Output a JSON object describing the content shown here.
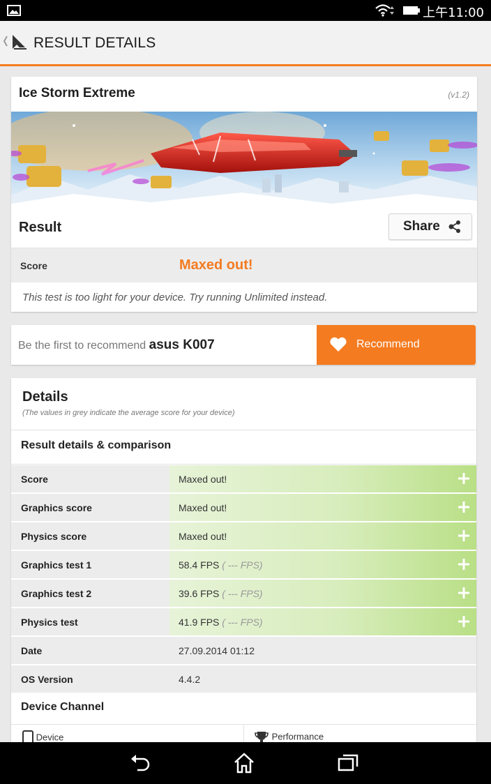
{
  "status_bar": {
    "time": "上午11:00"
  },
  "app_bar": {
    "title": "RESULT DETAILS"
  },
  "test": {
    "name": "Ice Storm Extreme",
    "version": "(v1.2)",
    "result_label": "Result",
    "share_label": "Share",
    "score_label": "Score",
    "score_value": "Maxed out!",
    "note": "This test is too light for your device. Try running Unlimited instead."
  },
  "recommend": {
    "prefix": "Be the first to recommend",
    "device": "asus K007",
    "button_label": "Recommend"
  },
  "details": {
    "heading": "Details",
    "subheading": "(The values in grey indicate the average score for your device)",
    "section_title": "Result details & comparison",
    "rows": [
      {
        "label": "Score",
        "value": "Maxed out!",
        "avg": ""
      },
      {
        "label": "Graphics score",
        "value": "Maxed out!",
        "avg": ""
      },
      {
        "label": "Physics score",
        "value": "Maxed out!",
        "avg": ""
      },
      {
        "label": "Graphics test 1",
        "value": "58.4 FPS",
        "avg": "( --- FPS)"
      },
      {
        "label": "Graphics test 2",
        "value": "39.6 FPS",
        "avg": "( --- FPS)"
      },
      {
        "label": "Physics test",
        "value": "41.9 FPS",
        "avg": "( --- FPS)"
      }
    ],
    "info_rows": [
      {
        "label": "Date",
        "value": "27.09.2014 01:12"
      },
      {
        "label": "OS Version",
        "value": "4.4.2"
      }
    ],
    "channel_title": "Device Channel",
    "channel_tabs": [
      "Device",
      "Performance"
    ]
  },
  "colors": {
    "accent": "#f47b20",
    "bar_light": "#e7f3d8",
    "bar_dark": "#b9df86"
  }
}
